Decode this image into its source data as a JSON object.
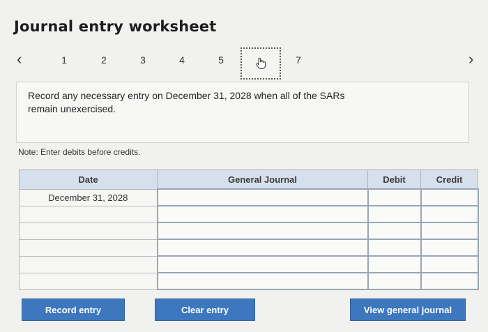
{
  "page": {
    "title": "Journal entry worksheet"
  },
  "nav": {
    "prev_icon": "chevron-left-icon",
    "next_icon": "chevron-right-icon",
    "tabs": [
      "1",
      "2",
      "3",
      "4",
      "5",
      "6",
      "7"
    ],
    "current_tab": "6",
    "current_tab_icon": "hand-pointer-icon"
  },
  "prompt": {
    "line1": "Record any necessary entry on December 31, 2028 when all of the SARs",
    "line2": "remain unexercised."
  },
  "note": "Note: Enter debits before credits.",
  "table": {
    "headers": {
      "date": "Date",
      "journal": "General Journal",
      "debit": "Debit",
      "credit": "Credit"
    },
    "rows": [
      {
        "date": "December 31, 2028",
        "account": "",
        "debit": "",
        "credit": ""
      },
      {
        "date": "",
        "account": "",
        "debit": "",
        "credit": ""
      },
      {
        "date": "",
        "account": "",
        "debit": "",
        "credit": ""
      },
      {
        "date": "",
        "account": "",
        "debit": "",
        "credit": ""
      },
      {
        "date": "",
        "account": "",
        "debit": "",
        "credit": ""
      },
      {
        "date": "",
        "account": "",
        "debit": "",
        "credit": ""
      }
    ]
  },
  "buttons": {
    "record": "Record entry",
    "clear": "Clear entry",
    "view": "View general journal"
  },
  "colors": {
    "header_bg": "#d6e0ec",
    "button_bg": "#3d78bf"
  }
}
